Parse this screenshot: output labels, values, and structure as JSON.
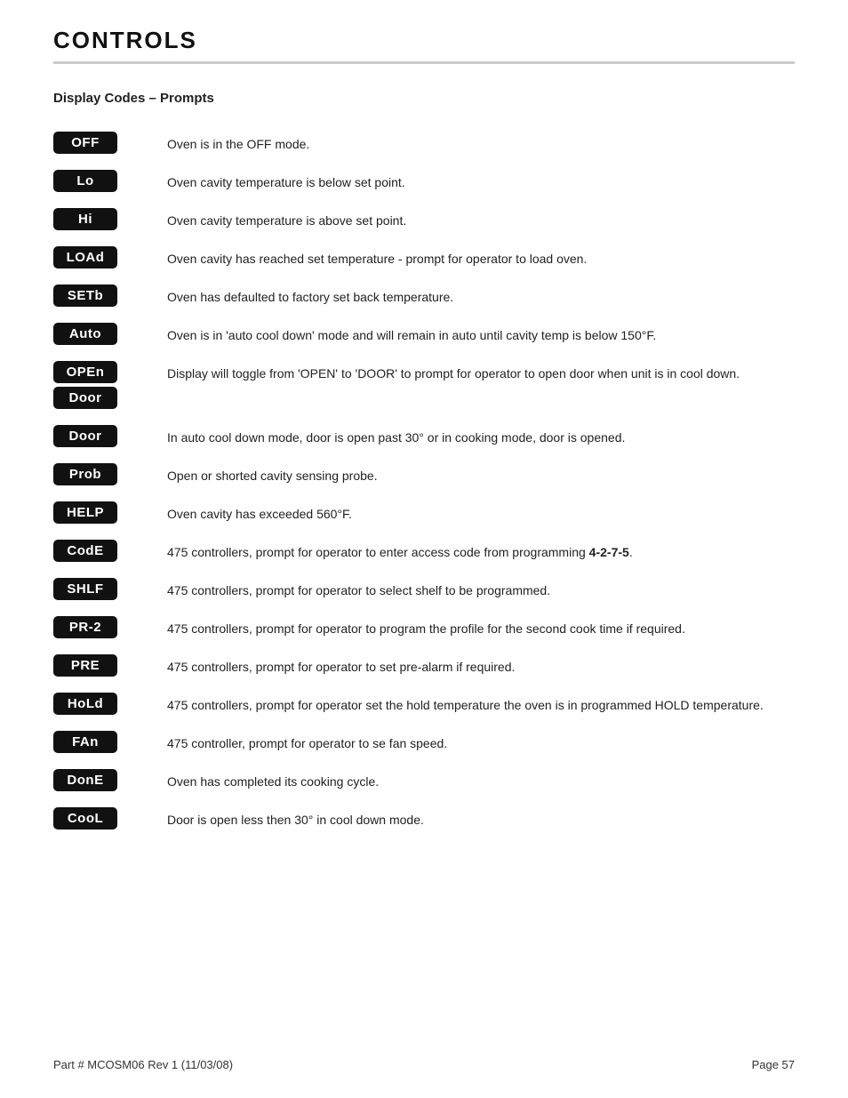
{
  "header": {
    "title": "CONTROLS"
  },
  "section": {
    "title": "Display Codes – Prompts"
  },
  "codes": [
    {
      "badges": [
        "OFF"
      ],
      "description": "Oven is in the OFF mode."
    },
    {
      "badges": [
        "Lo"
      ],
      "description": "Oven cavity temperature is below set point."
    },
    {
      "badges": [
        "Hi"
      ],
      "description": "Oven cavity temperature is above set point."
    },
    {
      "badges": [
        "LOAd"
      ],
      "description": "Oven cavity has reached set temperature - prompt for operator to load oven."
    },
    {
      "badges": [
        "SETb"
      ],
      "description": "Oven has defaulted to factory set back temperature."
    },
    {
      "badges": [
        "Auto"
      ],
      "description": "Oven is in 'auto cool down' mode and will remain in auto until cavity temp is below 150°F."
    },
    {
      "badges": [
        "OPEn",
        "Door"
      ],
      "description": "Display will toggle from 'OPEN' to 'DOOR' to prompt for operator to open door when unit is in cool down."
    },
    {
      "badges": [
        "Door"
      ],
      "description": "In auto cool down mode, door is open past 30° or in cooking mode, door is opened."
    },
    {
      "badges": [
        "Prob"
      ],
      "description": "Open or shorted cavity sensing probe."
    },
    {
      "badges": [
        "HELP"
      ],
      "description": "Oven cavity has exceeded 560°F."
    },
    {
      "badges": [
        "CodE"
      ],
      "description": "475 controllers, prompt for operator to enter access code from programming 4-2-7-5."
    },
    {
      "badges": [
        "SHLF"
      ],
      "description": "475 controllers, prompt for operator to select shelf to be programmed."
    },
    {
      "badges": [
        "PR-2"
      ],
      "description": "475 controllers, prompt for operator to program the profile for the second cook time if required."
    },
    {
      "badges": [
        "PRE"
      ],
      "description": "475 controllers, prompt for operator to set pre-alarm if required."
    },
    {
      "badges": [
        "HoLd"
      ],
      "description": "475 controllers, prompt for operator set the hold temperature the oven is in programmed HOLD temperature."
    },
    {
      "badges": [
        "FAn"
      ],
      "description": "475 controller, prompt for operator to se fan speed."
    },
    {
      "badges": [
        "DonE"
      ],
      "description": "Oven has completed its cooking cycle."
    },
    {
      "badges": [
        "CooL"
      ],
      "description": "Door is open less then 30° in cool down mode."
    }
  ],
  "footer": {
    "left": "Part # MCOSM06 Rev 1 (11/03/08)",
    "right": "Page 57"
  }
}
